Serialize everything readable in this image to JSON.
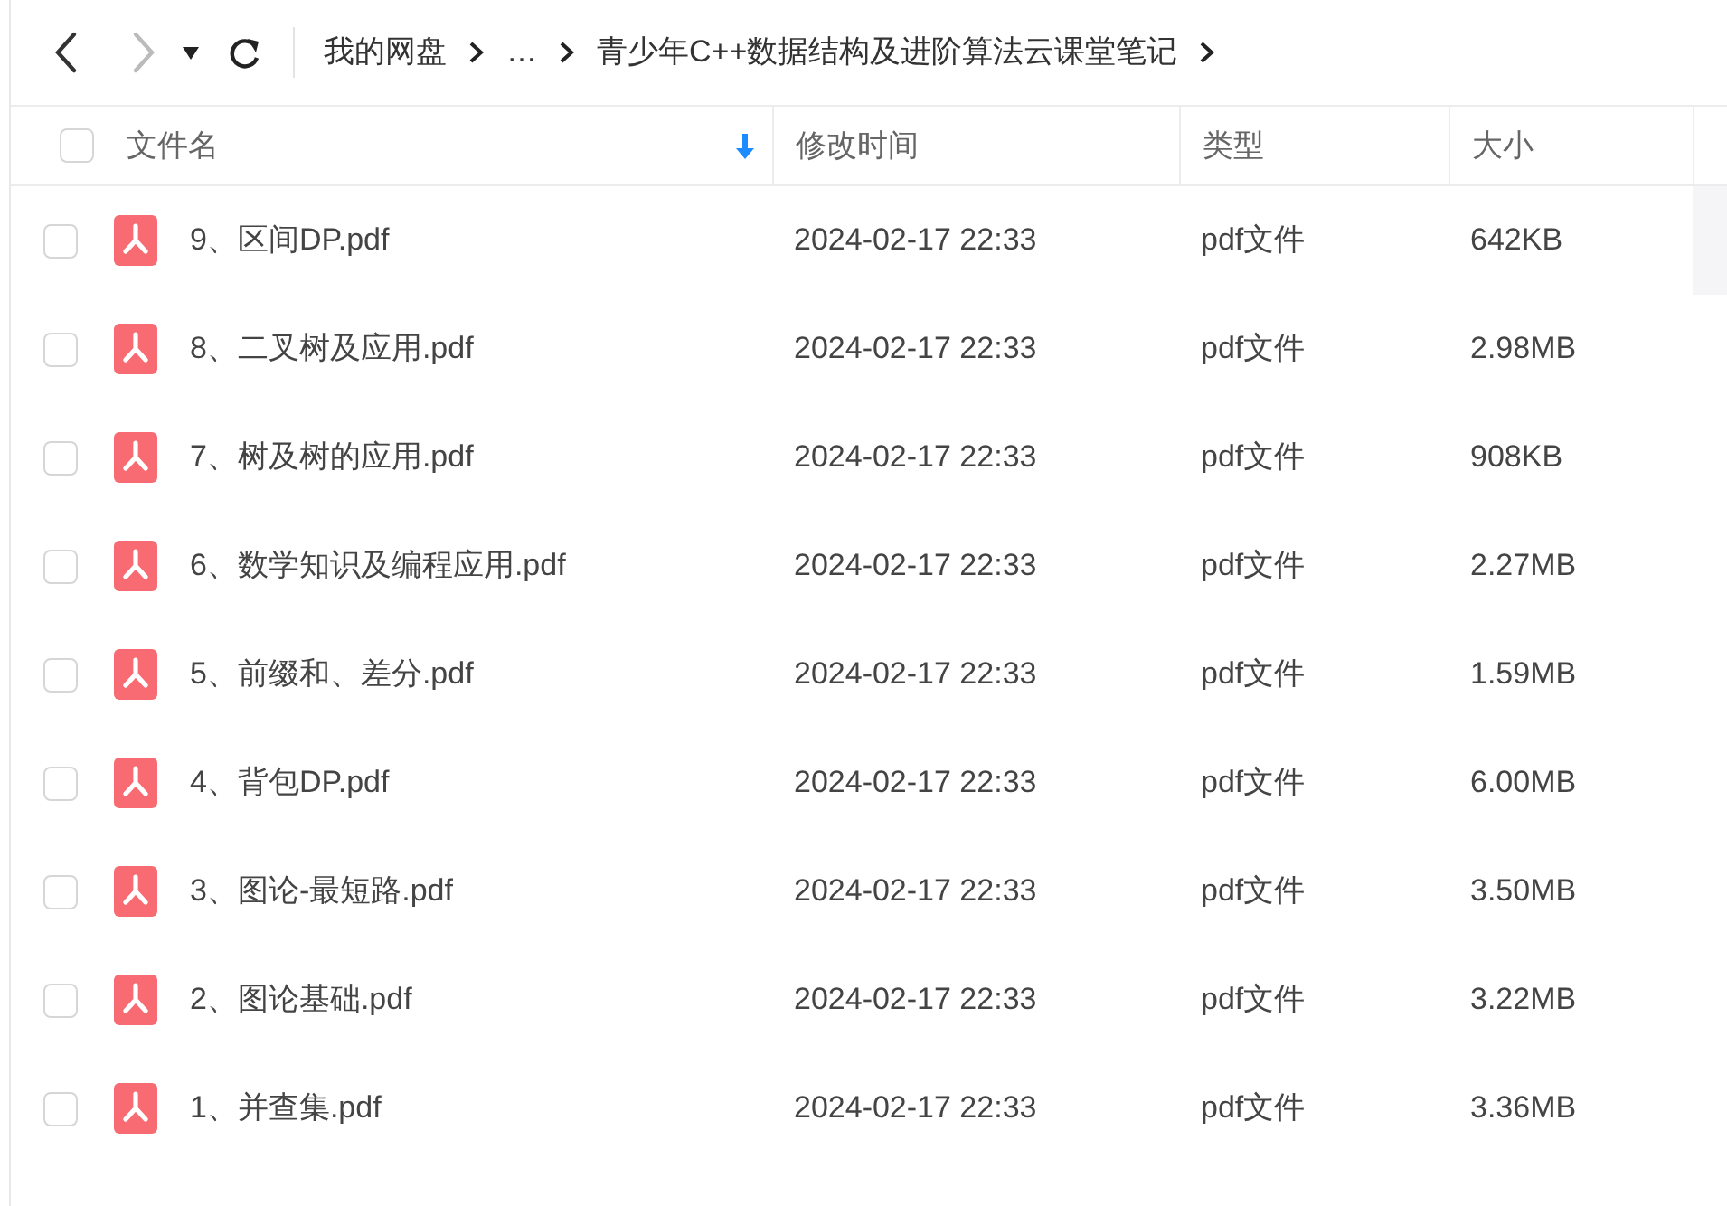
{
  "toolbar": {
    "breadcrumb": [
      "我的网盘",
      "…",
      "青少年C++数据结构及进阶算法云课堂笔记"
    ]
  },
  "table": {
    "columns": [
      {
        "label": "文件名",
        "sorted": true
      },
      {
        "label": "修改时间",
        "sorted": false
      },
      {
        "label": "类型",
        "sorted": false
      },
      {
        "label": "大小",
        "sorted": false
      }
    ],
    "select_all": {
      "checked": false
    },
    "rows": [
      {
        "name": "9、区间DP.pdf",
        "modified": "2024-02-17 22:33",
        "type": "pdf文件",
        "size": "642KB",
        "checked": false
      },
      {
        "name": "8、二叉树及应用.pdf",
        "modified": "2024-02-17 22:33",
        "type": "pdf文件",
        "size": "2.98MB",
        "checked": false
      },
      {
        "name": "7、树及树的应用.pdf",
        "modified": "2024-02-17 22:33",
        "type": "pdf文件",
        "size": "908KB",
        "checked": false
      },
      {
        "name": "6、数学知识及编程应用.pdf",
        "modified": "2024-02-17 22:33",
        "type": "pdf文件",
        "size": "2.27MB",
        "checked": false
      },
      {
        "name": "5、前缀和、差分.pdf",
        "modified": "2024-02-17 22:33",
        "type": "pdf文件",
        "size": "1.59MB",
        "checked": false
      },
      {
        "name": "4、背包DP.pdf",
        "modified": "2024-02-17 22:33",
        "type": "pdf文件",
        "size": "6.00MB",
        "checked": false
      },
      {
        "name": "3、图论-最短路.pdf",
        "modified": "2024-02-17 22:33",
        "type": "pdf文件",
        "size": "3.50MB",
        "checked": false
      },
      {
        "name": "2、图论基础.pdf",
        "modified": "2024-02-17 22:33",
        "type": "pdf文件",
        "size": "3.22MB",
        "checked": false
      },
      {
        "name": "1、并查集.pdf",
        "modified": "2024-02-17 22:33",
        "type": "pdf文件",
        "size": "3.36MB",
        "checked": false
      }
    ]
  }
}
